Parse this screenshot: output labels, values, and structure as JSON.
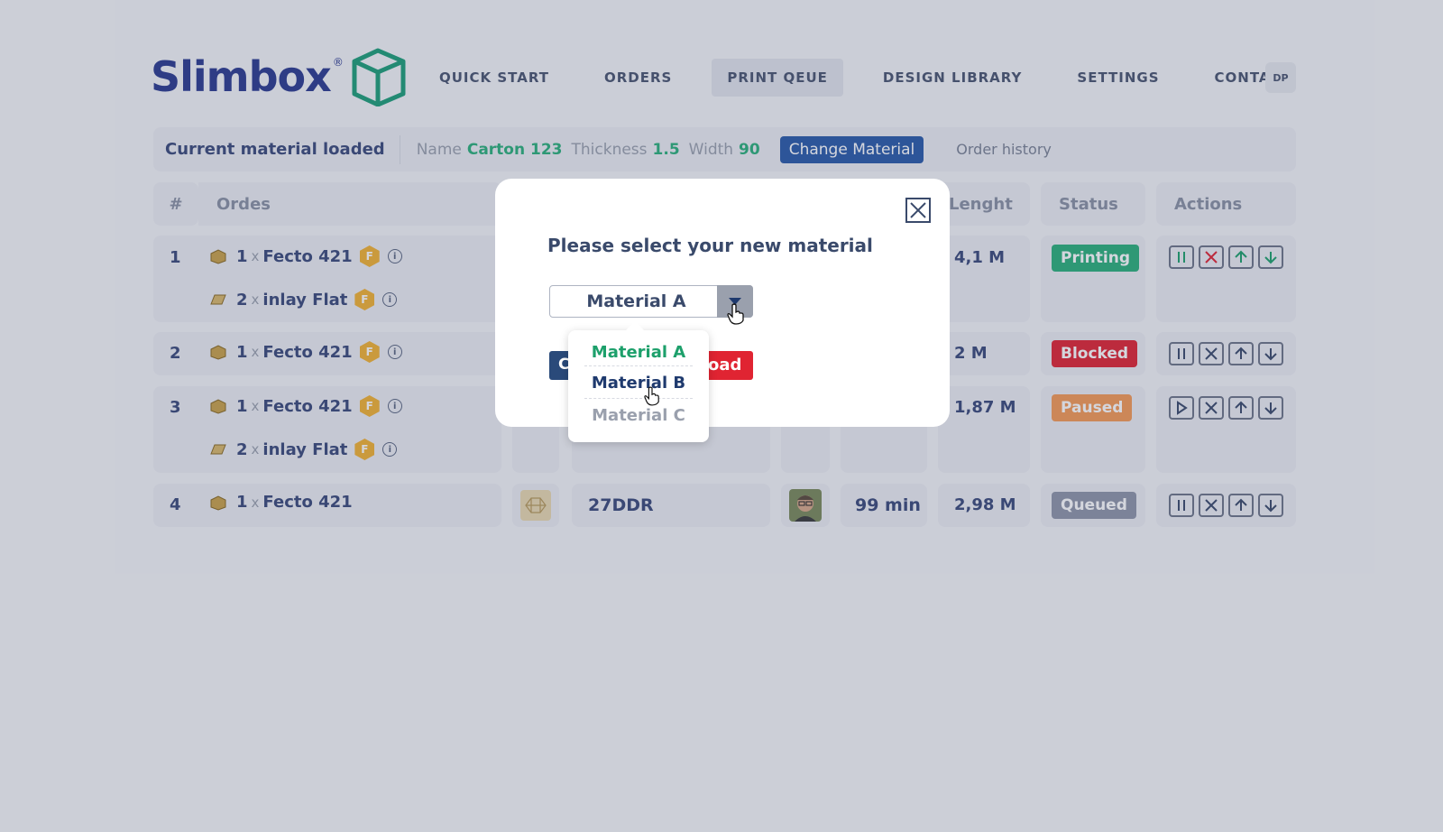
{
  "brand": {
    "name": "Slimbox",
    "reg": "®"
  },
  "nav": {
    "items": [
      {
        "label": "QUICK START",
        "active": false
      },
      {
        "label": "ORDERS",
        "active": false
      },
      {
        "label": "PRINT QEUE",
        "active": true
      },
      {
        "label": "DESIGN LIBRARY",
        "active": false
      },
      {
        "label": "SETTINGS",
        "active": false
      },
      {
        "label": "CONTACT",
        "active": false
      }
    ],
    "user_initials": "DP"
  },
  "material_bar": {
    "label": "Current material loaded",
    "name_label": "Name",
    "name_value": "Carton 123",
    "thickness_label": "Thickness",
    "thickness_value": "1.5",
    "width_label": "Width",
    "width_value": "90",
    "change_button": "Change Material",
    "history_link": "Order history"
  },
  "table": {
    "headers": {
      "num": "#",
      "orders": "Ordes",
      "length": "Lenght",
      "status": "Status",
      "actions": "Actions"
    },
    "rows": [
      {
        "num": "1",
        "items": [
          {
            "qty": "1",
            "x": "x",
            "name": "Fecto 421",
            "badge": "F"
          },
          {
            "qty": "2",
            "x": "x",
            "name": "inlay Flat",
            "badge": "F"
          }
        ],
        "length": "4,1 M",
        "status": "Printing",
        "status_color": "#2bb07a",
        "actions": [
          "pause-icon",
          "cancel-icon",
          "up-arrow-icon",
          "down-arrow-icon"
        ]
      },
      {
        "num": "2",
        "items": [
          {
            "qty": "1",
            "x": "x",
            "name": "Fecto 421",
            "badge": "F"
          }
        ],
        "length": "2 M",
        "status": "Blocked",
        "status_color": "#e02432",
        "actions": [
          "pause-icon",
          "cancel-icon",
          "up-arrow-icon",
          "down-arrow-icon"
        ]
      },
      {
        "num": "3",
        "items": [
          {
            "qty": "1",
            "x": "x",
            "name": "Fecto 421",
            "badge": "F"
          },
          {
            "qty": "2",
            "x": "x",
            "name": "inlay Flat",
            "badge": "F"
          }
        ],
        "length": "1,87 M",
        "status": "Paused",
        "status_color": "#f59a55",
        "actions": [
          "play-icon",
          "cancel-icon",
          "up-arrow-icon",
          "down-arrow-icon"
        ]
      },
      {
        "num": "4",
        "items": [
          {
            "qty": "1",
            "x": "x",
            "name": "Fecto 421",
            "badge": ""
          }
        ],
        "design_code": "27DDR",
        "time": "99 min",
        "length": "2,98 M",
        "status": "Queued",
        "status_color": "#8f95a8",
        "actions": [
          "pause-icon",
          "cancel-icon",
          "up-arrow-icon",
          "down-arrow-icon"
        ]
      }
    ]
  },
  "modal": {
    "title": "Please select your new material",
    "selected": "Material A",
    "button_left": "C",
    "button_load": "oad",
    "options": [
      {
        "label": "Material A",
        "color": "#1da06b"
      },
      {
        "label": "Material B",
        "color": "#1f3a6e"
      },
      {
        "label": "Material C",
        "color": "#9aa0ad"
      }
    ]
  }
}
